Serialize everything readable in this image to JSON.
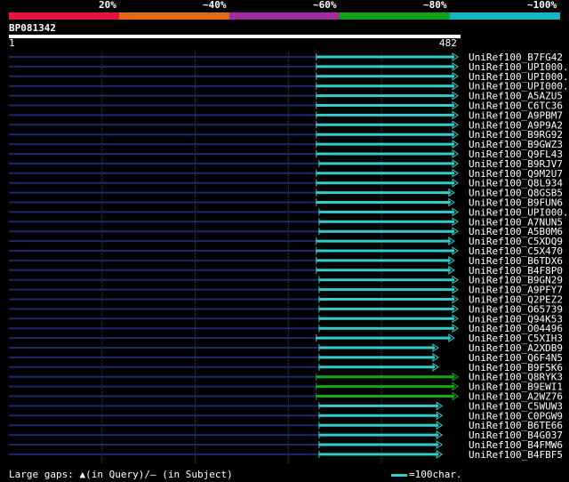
{
  "chart_data": {
    "type": "alignment-overview",
    "query": {
      "name": "BP081342",
      "start": "1",
      "end": "482",
      "length": 482
    },
    "identity_legend": [
      {
        "label": "20%",
        "color": "#e0143c"
      },
      {
        "label": "~40%",
        "color": "#e06a14"
      },
      {
        "label": "~60%",
        "color": "#a02ca0"
      },
      {
        "label": "~80%",
        "color": "#14a014"
      },
      {
        "label": "~100%",
        "color": "#14b4c0"
      }
    ],
    "hits": [
      {
        "name": "UniRef100_B7FG42",
        "start": 1,
        "qstart": 330,
        "end": 482,
        "color": "#3cc"
      },
      {
        "name": "UniRef100_UPI000..",
        "start": 1,
        "qstart": 330,
        "end": 482,
        "color": "#3cc"
      },
      {
        "name": "UniRef100_UPI000..",
        "start": 1,
        "qstart": 330,
        "end": 482,
        "color": "#3cc"
      },
      {
        "name": "UniRef100_UPI000..",
        "start": 1,
        "qstart": 330,
        "end": 482,
        "color": "#3cc"
      },
      {
        "name": "UniRef100_A5AZU5",
        "start": 1,
        "qstart": 330,
        "end": 482,
        "color": "#3cc"
      },
      {
        "name": "UniRef100_C6TC36",
        "start": 1,
        "qstart": 330,
        "end": 482,
        "color": "#3cc"
      },
      {
        "name": "UniRef100_A9PBM7",
        "start": 1,
        "qstart": 330,
        "end": 482,
        "color": "#3cc"
      },
      {
        "name": "UniRef100_A9P9A2",
        "start": 1,
        "qstart": 330,
        "end": 482,
        "color": "#3cc"
      },
      {
        "name": "UniRef100_B9RG92",
        "start": 1,
        "qstart": 330,
        "end": 482,
        "color": "#3cc"
      },
      {
        "name": "UniRef100_B9GWZ3",
        "start": 1,
        "qstart": 330,
        "end": 482,
        "color": "#3cc"
      },
      {
        "name": "UniRef100_Q9FL43",
        "start": 1,
        "qstart": 330,
        "end": 482,
        "color": "#3cc"
      },
      {
        "name": "UniRef100_B9RJV7",
        "start": 1,
        "qstart": 333,
        "end": 482,
        "color": "#3cc"
      },
      {
        "name": "UniRef100_Q9M2U7",
        "start": 1,
        "qstart": 330,
        "end": 482,
        "color": "#3cc"
      },
      {
        "name": "UniRef100_Q8L934",
        "start": 1,
        "qstart": 330,
        "end": 482,
        "color": "#3cc"
      },
      {
        "name": "UniRef100_Q8GSB5",
        "start": 1,
        "qstart": 330,
        "end": 478,
        "color": "#3cc"
      },
      {
        "name": "UniRef100_B9FUN6",
        "start": 1,
        "qstart": 330,
        "end": 478,
        "color": "#3cc"
      },
      {
        "name": "UniRef100_UPI000..",
        "start": 1,
        "qstart": 333,
        "end": 482,
        "color": "#3cc"
      },
      {
        "name": "UniRef100_A7NUN5",
        "start": 1,
        "qstart": 333,
        "end": 482,
        "color": "#3cc"
      },
      {
        "name": "UniRef100_A5B0M6",
        "start": 1,
        "qstart": 333,
        "end": 482,
        "color": "#3cc"
      },
      {
        "name": "UniRef100_C5XDQ9",
        "start": 1,
        "qstart": 330,
        "end": 478,
        "color": "#3cc"
      },
      {
        "name": "UniRef100_C5X470",
        "start": 1,
        "qstart": 330,
        "end": 482,
        "color": "#3cc"
      },
      {
        "name": "UniRef100_B6TDX6",
        "start": 1,
        "qstart": 330,
        "end": 478,
        "color": "#3cc"
      },
      {
        "name": "UniRef100_B4F8P0",
        "start": 1,
        "qstart": 330,
        "end": 478,
        "color": "#3cc"
      },
      {
        "name": "UniRef100_B9GN29",
        "start": 1,
        "qstart": 333,
        "end": 482,
        "color": "#3cc"
      },
      {
        "name": "UniRef100_A9PFY7",
        "start": 1,
        "qstart": 333,
        "end": 482,
        "color": "#3cc"
      },
      {
        "name": "UniRef100_Q2PEZ2",
        "start": 1,
        "qstart": 333,
        "end": 482,
        "color": "#3cc"
      },
      {
        "name": "UniRef100_O65739",
        "start": 1,
        "qstart": 333,
        "end": 482,
        "color": "#3cc"
      },
      {
        "name": "UniRef100_Q94K53",
        "start": 1,
        "qstart": 333,
        "end": 482,
        "color": "#3cc"
      },
      {
        "name": "UniRef100_O04496",
        "start": 1,
        "qstart": 333,
        "end": 482,
        "color": "#3cc"
      },
      {
        "name": "UniRef100_C5XIH3",
        "start": 1,
        "qstart": 330,
        "end": 478,
        "color": "#3cc"
      },
      {
        "name": "UniRef100_A2XDB9",
        "start": 1,
        "qstart": 333,
        "end": 461,
        "color": "#3cc"
      },
      {
        "name": "UniRef100_Q6F4N5",
        "start": 1,
        "qstart": 333,
        "end": 461,
        "color": "#3cc"
      },
      {
        "name": "UniRef100_B9F5K6",
        "start": 1,
        "qstart": 333,
        "end": 461,
        "color": "#3cc"
      },
      {
        "name": "UniRef100_Q8RYK3",
        "start": 1,
        "qstart": 330,
        "end": 482,
        "color": "#1a1"
      },
      {
        "name": "UniRef100_B9EWI1",
        "start": 1,
        "qstart": 330,
        "end": 482,
        "color": "#1a1"
      },
      {
        "name": "UniRef100_A2WZ76",
        "start": 1,
        "qstart": 330,
        "end": 482,
        "color": "#1a1"
      },
      {
        "name": "UniRef100_C5WUW3",
        "start": 1,
        "qstart": 333,
        "end": 465,
        "color": "#3cc"
      },
      {
        "name": "UniRef100_C0PGW9",
        "start": 1,
        "qstart": 333,
        "end": 465,
        "color": "#3cc"
      },
      {
        "name": "UniRef100_B6TE66",
        "start": 1,
        "qstart": 333,
        "end": 465,
        "color": "#3cc"
      },
      {
        "name": "UniRef100_B4G037",
        "start": 1,
        "qstart": 333,
        "end": 465,
        "color": "#3cc"
      },
      {
        "name": "UniRef100_B4FMW6",
        "start": 1,
        "qstart": 333,
        "end": 465,
        "color": "#3cc"
      },
      {
        "name": "UniRef100_B4FBF5",
        "start": 1,
        "qstart": 333,
        "end": 465,
        "color": "#3cc"
      }
    ],
    "gridlines": [
      100,
      200,
      300,
      400
    ]
  },
  "footer": {
    "large_gaps_prefix": "Large gaps: ",
    "in_query_glyph": "▲",
    "in_query_text": "(in Query)/",
    "in_subject_glyph": "—",
    "in_subject_text": " (in Subject)",
    "scale_text": "=100char."
  },
  "colors": {
    "line": "#1a2a6a",
    "hit": "#3cc",
    "hit_green": "#1a1"
  }
}
